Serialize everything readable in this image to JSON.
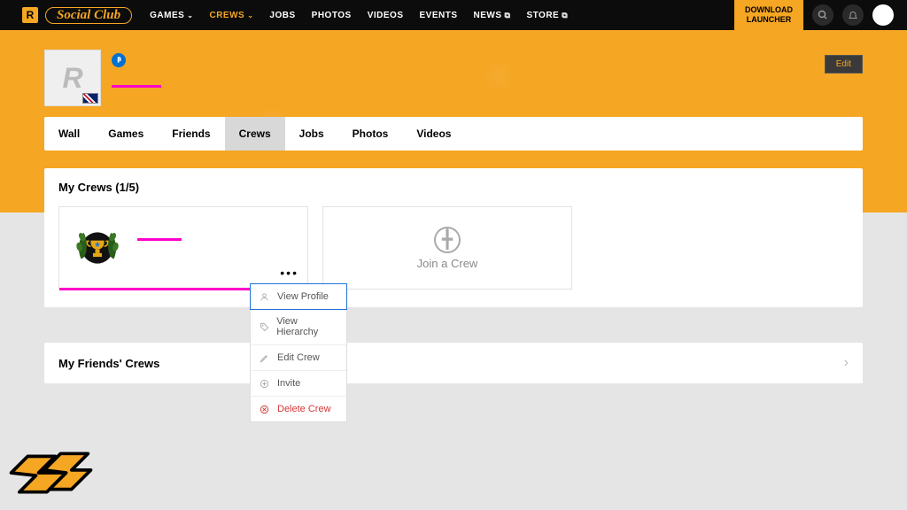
{
  "header": {
    "logo_text": "Social Club",
    "nav": [
      {
        "label": "GAMES",
        "dropdown": true,
        "active": false
      },
      {
        "label": "CREWS",
        "dropdown": true,
        "active": true
      },
      {
        "label": "JOBS",
        "dropdown": false,
        "active": false
      },
      {
        "label": "PHOTOS",
        "dropdown": false,
        "active": false
      },
      {
        "label": "VIDEOS",
        "dropdown": false,
        "active": false
      },
      {
        "label": "EVENTS",
        "dropdown": false,
        "active": false
      },
      {
        "label": "NEWS",
        "dropdown": false,
        "active": false,
        "external": true
      },
      {
        "label": "STORE",
        "dropdown": false,
        "active": false,
        "external": true
      }
    ],
    "download_line1": "DOWNLOAD",
    "download_line2": "LAUNCHER"
  },
  "profile": {
    "edit_label": "Edit"
  },
  "tabs": [
    {
      "label": "Wall",
      "active": false
    },
    {
      "label": "Games",
      "active": false
    },
    {
      "label": "Friends",
      "active": false
    },
    {
      "label": "Crews",
      "active": true
    },
    {
      "label": "Jobs",
      "active": false
    },
    {
      "label": "Photos",
      "active": false
    },
    {
      "label": "Videos",
      "active": false
    }
  ],
  "my_crews": {
    "title": "My Crews (1/5)",
    "join_label": "Join a Crew"
  },
  "dropdown": {
    "items": [
      {
        "label": "View Profile",
        "icon": "user",
        "highlight": true
      },
      {
        "label": "View Hierarchy",
        "icon": "tag"
      },
      {
        "label": "Edit Crew",
        "icon": "pencil"
      },
      {
        "label": "Invite",
        "icon": "plus-circle"
      },
      {
        "label": "Delete Crew",
        "icon": "x-circle",
        "danger": true
      }
    ]
  },
  "friends_crews": {
    "title": "My Friends' Crews"
  }
}
